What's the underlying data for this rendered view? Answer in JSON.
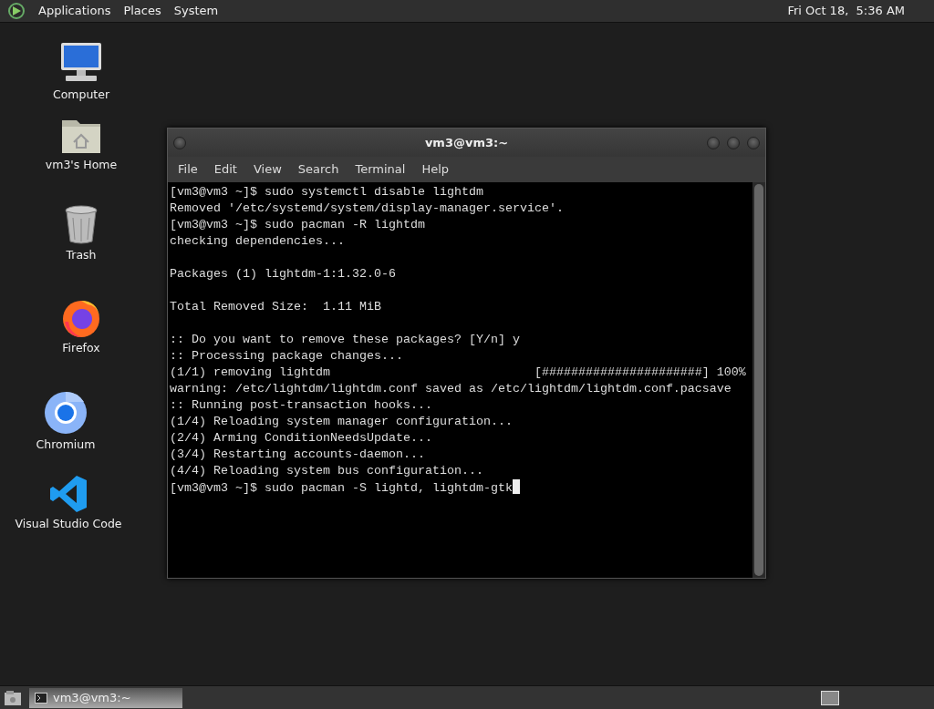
{
  "top_panel": {
    "menus": [
      "Applications",
      "Places",
      "System"
    ],
    "clock": "Fri Oct 18,  5:36 AM"
  },
  "desktop_icons": [
    {
      "kind": "computer",
      "label": "Computer"
    },
    {
      "kind": "home",
      "label": "vm3's Home"
    },
    {
      "kind": "trash",
      "label": "Trash"
    },
    {
      "kind": "firefox",
      "label": "Firefox"
    },
    {
      "kind": "chromium",
      "label": "Chromium"
    },
    {
      "kind": "vscode",
      "label": "Visual Studio Code"
    }
  ],
  "terminal_window": {
    "title": "vm3@vm3:~",
    "menus": [
      "File",
      "Edit",
      "View",
      "Search",
      "Terminal",
      "Help"
    ],
    "lines": [
      {
        "kind": "text",
        "text": "[vm3@vm3 ~]$ sudo systemctl disable lightdm"
      },
      {
        "kind": "text",
        "text": "Removed '/etc/systemd/system/display-manager.service'."
      },
      {
        "kind": "text",
        "text": "[vm3@vm3 ~]$ sudo pacman -R lightdm"
      },
      {
        "kind": "text",
        "text": "checking dependencies..."
      },
      {
        "kind": "blank"
      },
      {
        "kind": "text",
        "text": "Packages (1) lightdm-1:1.32.0-6"
      },
      {
        "kind": "blank"
      },
      {
        "kind": "text",
        "text": "Total Removed Size:  1.11 MiB"
      },
      {
        "kind": "blank"
      },
      {
        "kind": "text",
        "text": ":: Do you want to remove these packages? [Y/n] y"
      },
      {
        "kind": "text",
        "text": ":: Processing package changes..."
      },
      {
        "kind": "text",
        "text": "(1/1) removing lightdm                            [######################] 100%"
      },
      {
        "kind": "text",
        "text": "warning: /etc/lightdm/lightdm.conf saved as /etc/lightdm/lightdm.conf.pacsave"
      },
      {
        "kind": "text",
        "text": ":: Running post-transaction hooks..."
      },
      {
        "kind": "text",
        "text": "(1/4) Reloading system manager configuration..."
      },
      {
        "kind": "text",
        "text": "(2/4) Arming ConditionNeedsUpdate..."
      },
      {
        "kind": "text",
        "text": "(3/4) Restarting accounts-daemon..."
      },
      {
        "kind": "text",
        "text": "(4/4) Reloading system bus configuration..."
      },
      {
        "kind": "text",
        "text": "[vm3@vm3 ~]$ sudo pacman -S lightd, lightdm-gtk"
      }
    ]
  },
  "taskbar": {
    "tasks": [
      {
        "label": "vm3@vm3:~",
        "selected": true
      }
    ]
  }
}
